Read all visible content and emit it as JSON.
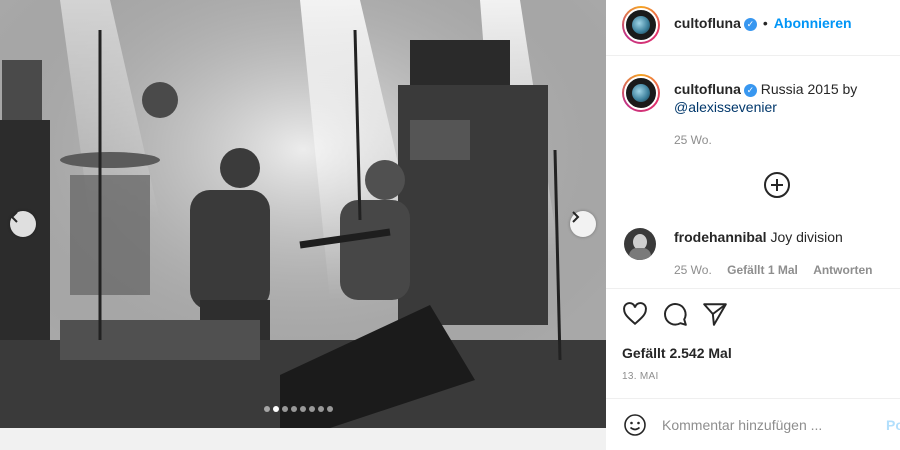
{
  "photo": {
    "alt": "Black and white concert photo of band on stage",
    "slide_count": 8,
    "active_slide": 2
  },
  "header": {
    "username": "cultofluna",
    "separator": "•",
    "follow_label": "Abonnieren"
  },
  "caption": {
    "username": "cultofluna",
    "text": "Russia 2015 by",
    "mention": "@alexissevenier",
    "time": "25 Wo."
  },
  "comment": {
    "username": "frodehannibal",
    "text": "Joy division",
    "time": "25 Wo.",
    "likes": "Gefällt 1 Mal",
    "reply": "Antworten"
  },
  "actions": {
    "likes_label": "Gefällt 2.542 Mal",
    "date": "13. MAI"
  },
  "comment_box": {
    "placeholder": "Kommentar hinzufügen ...",
    "post_label": "Posten"
  },
  "icons": [
    "chevron-left-icon",
    "chevron-right-icon",
    "plus-circle-icon",
    "heart-icon",
    "comment-icon",
    "share-icon",
    "emoji-icon",
    "verified-icon"
  ]
}
